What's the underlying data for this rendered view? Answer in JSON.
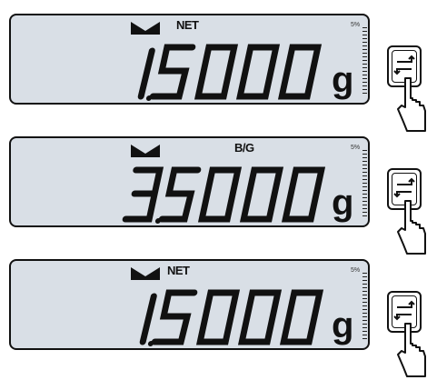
{
  "displays": [
    {
      "stable_icon": "stable-indicator-icon",
      "mode": "NET",
      "value": "1.5000",
      "unit": "g",
      "bargraph_label": "5%"
    },
    {
      "stable_icon": "stable-indicator-icon",
      "mode": "B/G",
      "value": "3.5000",
      "unit": "g",
      "bargraph_label": "5%"
    },
    {
      "stable_icon": "stable-indicator-icon",
      "mode": "NET",
      "value": "1.5000",
      "unit": "g",
      "bargraph_label": "5%"
    }
  ],
  "key_icon": "tare-key-icon",
  "hand_icon": "pressing-hand-icon",
  "lcd_color": "#d9dfe6"
}
